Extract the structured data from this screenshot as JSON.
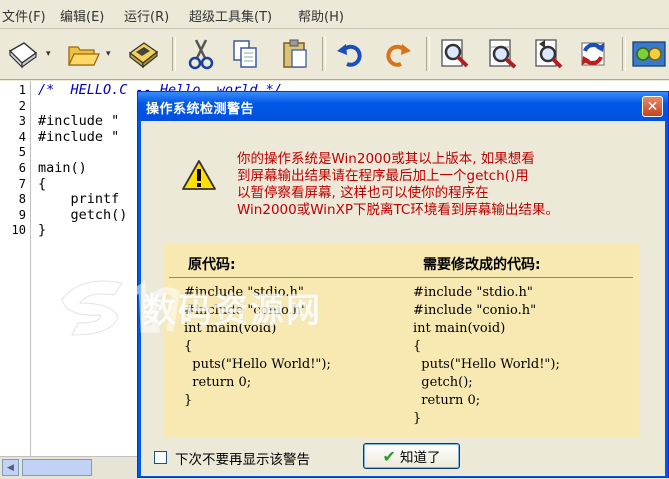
{
  "menubar": {
    "items": [
      "文件(F)",
      "编辑(E)",
      "运行(R)",
      "超级工具集(T)",
      "帮助(H)"
    ]
  },
  "toolbar": {
    "buttons": [
      "new-file-icon",
      "open-folder-icon",
      "save-disk-icon",
      "cut-icon",
      "copy-icon",
      "paste-icon",
      "undo-icon",
      "redo-icon",
      "find-icon",
      "find-next-icon",
      "replace-icon",
      "refresh-icon",
      "compile-icon"
    ]
  },
  "editor": {
    "line_numbers": [
      "1",
      "2",
      "3",
      "4",
      "5",
      "6",
      "7",
      "8",
      "9",
      "10"
    ],
    "lines": [
      {
        "text": "/*  HELLO.C -- Hello, world */",
        "kind": "comment"
      },
      {
        "text": "",
        "kind": "code"
      },
      {
        "text": "#include \"",
        "kind": "code"
      },
      {
        "text": "#include \"",
        "kind": "code"
      },
      {
        "text": "",
        "kind": "code"
      },
      {
        "text": "main()",
        "kind": "code"
      },
      {
        "text": "{",
        "kind": "code"
      },
      {
        "text": "    printf",
        "kind": "code"
      },
      {
        "text": "    getch()",
        "kind": "code"
      },
      {
        "text": "}",
        "kind": "code"
      }
    ]
  },
  "dialog": {
    "title": "操作系统检测警告",
    "close_symbol": "✕",
    "message_lines": [
      "你的操作系统是Win2000或其以上版本, 如果想看",
      "到屏幕输出结果请在程序最后加上一个getch()用",
      "以暂停察看屏幕, 这样也可以使你的程序在",
      "Win2000或WinXP下脱离TC环境看到屏幕输出结果。"
    ],
    "original_heading": "原代码:",
    "modified_heading": "需要修改成的代码:",
    "original_code": [
      "#include \"stdio.h\"",
      "#include \"conio.h\"",
      "int main(void)",
      "{",
      "  puts(\"Hello World!\");",
      "  return 0;",
      "}"
    ],
    "modified_code": [
      "#include \"stdio.h\"",
      "#include \"conio.h\"",
      "int main(void)",
      "{",
      "  puts(\"Hello World!\");",
      "  getch();",
      "  return 0;",
      "}"
    ],
    "dont_show_label": "下次不要再显示该警告",
    "dont_show_checked": false,
    "ok_label": "知道了"
  },
  "watermark": {
    "text": "数码资源网"
  },
  "colors": {
    "title_bar": "#0058e6",
    "warning_text": "#c00000",
    "code_panel": "#f7e9b1",
    "comment": "#0000c0"
  }
}
